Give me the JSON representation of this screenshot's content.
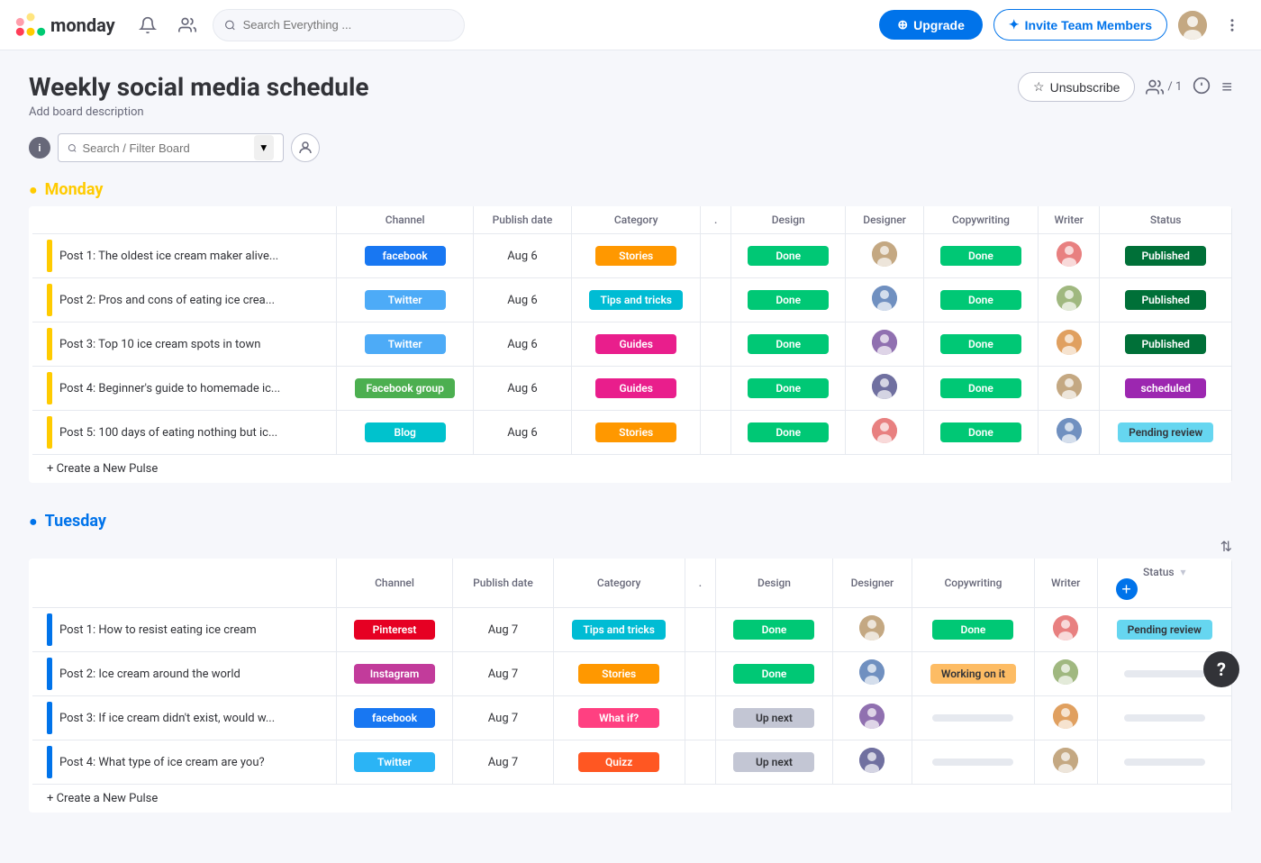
{
  "topnav": {
    "logo_text": "monday",
    "search_placeholder": "Search Everything ...",
    "upgrade_label": "Upgrade",
    "invite_label": "Invite Team Members"
  },
  "board": {
    "title": "Weekly social media schedule",
    "description": "Add board description",
    "unsubscribe_label": "Unsubscribe",
    "members_count": "/ 1"
  },
  "filter_bar": {
    "search_placeholder": "Search / Filter Board"
  },
  "columns": {
    "name": "",
    "channel": "Channel",
    "publish_date": "Publish date",
    "category": "Category",
    "dot": ".",
    "design": "Design",
    "designer": "Designer",
    "copywriting": "Copywriting",
    "writer": "Writer",
    "status": "Status"
  },
  "monday": {
    "title": "Monday",
    "rows": [
      {
        "name": "Post 1: The oldest ice cream maker alive...",
        "channel": "facebook",
        "channel_class": "pill-facebook",
        "publish_date": "Aug 6",
        "category": "Stories",
        "category_class": "pill-stories",
        "design": "Done",
        "design_class": "pill-done",
        "copywriting": "Done",
        "copywriting_class": "pill-done",
        "status": "Published",
        "status_class": "pill-published"
      },
      {
        "name": "Post 2: Pros and cons of eating ice crea...",
        "channel": "Twitter",
        "channel_class": "pill-twitter",
        "publish_date": "Aug 6",
        "category": "Tips and tricks",
        "category_class": "pill-tips",
        "design": "Done",
        "design_class": "pill-done",
        "copywriting": "Done",
        "copywriting_class": "pill-done",
        "status": "Published",
        "status_class": "pill-published"
      },
      {
        "name": "Post 3: Top 10 ice cream spots in town",
        "channel": "Twitter",
        "channel_class": "pill-twitter",
        "publish_date": "Aug 6",
        "category": "Guides",
        "category_class": "pill-guides",
        "design": "Done",
        "design_class": "pill-done",
        "copywriting": "Done",
        "copywriting_class": "pill-done",
        "status": "Published",
        "status_class": "pill-published"
      },
      {
        "name": "Post 4: Beginner's guide to homemade ic...",
        "channel": "Facebook group",
        "channel_class": "pill-facebook-group",
        "publish_date": "Aug 6",
        "category": "Guides",
        "category_class": "pill-guides",
        "design": "Done",
        "design_class": "pill-done",
        "copywriting": "Done",
        "copywriting_class": "pill-done",
        "status": "scheduled",
        "status_class": "pill-scheduled"
      },
      {
        "name": "Post 5: 100 days of eating nothing but ic...",
        "channel": "Blog",
        "channel_class": "pill-blog",
        "publish_date": "Aug 6",
        "category": "Stories",
        "category_class": "pill-stories",
        "design": "Done",
        "design_class": "pill-done",
        "copywriting": "Done",
        "copywriting_class": "pill-done",
        "status": "Pending review",
        "status_class": "pill-pending"
      }
    ],
    "new_pulse_label": "+ Create a New Pulse"
  },
  "tuesday": {
    "title": "Tuesday",
    "rows": [
      {
        "name": "Post 1: How to resist eating ice cream",
        "channel": "Pinterest",
        "channel_class": "pill-pinterest",
        "publish_date": "Aug 7",
        "category": "Tips and tricks",
        "category_class": "pill-tips",
        "design": "Done",
        "design_class": "pill-done",
        "copywriting": "Done",
        "copywriting_class": "pill-done",
        "status": "Pending review",
        "status_class": "pill-pending"
      },
      {
        "name": "Post 2: Ice cream around the world",
        "channel": "Instagram",
        "channel_class": "pill-instagram",
        "publish_date": "Aug 7",
        "category": "Stories",
        "category_class": "pill-stories",
        "design": "Done",
        "design_class": "pill-done",
        "copywriting": "Working on it",
        "copywriting_class": "pill-working",
        "status": "",
        "status_class": "pill-empty"
      },
      {
        "name": "Post 3: If ice cream didn't exist, would w...",
        "channel": "facebook",
        "channel_class": "pill-facebook",
        "publish_date": "Aug 7",
        "category": "What if?",
        "category_class": "pill-whatif",
        "design": "Up next",
        "design_class": "pill-upnext",
        "copywriting": "",
        "copywriting_class": "pill-empty",
        "status": "",
        "status_class": "pill-empty"
      },
      {
        "name": "Post 4: What type of ice cream are you?",
        "channel": "Twitter",
        "channel_class": "pill-twitter-blue",
        "publish_date": "Aug 7",
        "category": "Quizz",
        "category_class": "pill-quizz",
        "design": "Up next",
        "design_class": "pill-upnext",
        "copywriting": "",
        "copywriting_class": "pill-empty",
        "status": "",
        "status_class": "pill-empty"
      }
    ],
    "new_pulse_label": "+ Create a New Pulse"
  },
  "help": {
    "label": "?"
  },
  "avatars": {
    "female1": "#c4a882",
    "female2": "#a0785a",
    "male1": "#8a9bb0",
    "male2": "#7a6e8c",
    "cat": "#d4a070"
  }
}
